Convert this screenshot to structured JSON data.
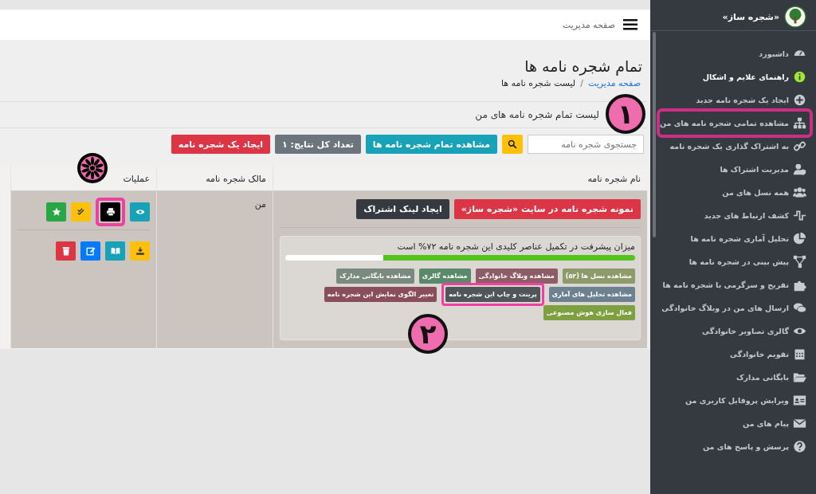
{
  "topbar": {
    "title": "صفحه مدیریت"
  },
  "sidebar": {
    "brand": "«شجره ساز»",
    "items": [
      {
        "label": "داشبورد",
        "emphasized": false,
        "annotated": false
      },
      {
        "label": "راهنمای علایم و اشکال",
        "emphasized": true,
        "annotated": false
      },
      {
        "label": "ایجاد یک شجره نامه جدید",
        "emphasized": false,
        "annotated": false
      },
      {
        "label": "مشاهده تمامی شجره نامه های من",
        "emphasized": false,
        "annotated": true
      },
      {
        "label": "به اشتراک گذاری یک شجره نامه",
        "emphasized": false,
        "annotated": false
      },
      {
        "label": "مدیریت اشتراک ها",
        "emphasized": false,
        "annotated": false
      },
      {
        "label": "همه نسل های من",
        "emphasized": false,
        "annotated": false
      },
      {
        "label": "کشف ارتباط های جدید",
        "emphasized": false,
        "annotated": false
      },
      {
        "label": "تحلیل آماری شجره نامه ها",
        "emphasized": false,
        "annotated": false
      },
      {
        "label": "پیش بینی در شجره نامه ها",
        "emphasized": false,
        "annotated": false
      },
      {
        "label": "تفریح و سرگرمی با شجره نامه ها",
        "emphasized": false,
        "annotated": false
      },
      {
        "label": "ارسال های من در وبلاگ خانوادگی",
        "emphasized": false,
        "annotated": false
      },
      {
        "label": "گالری تصاویر خانوادگی",
        "emphasized": false,
        "annotated": false
      },
      {
        "label": "تقویم خانوادگی",
        "emphasized": false,
        "annotated": false
      },
      {
        "label": "بایگانی مدارک",
        "emphasized": false,
        "annotated": false
      },
      {
        "label": "ویرایش پروفایل کاربری من",
        "emphasized": false,
        "annotated": false
      },
      {
        "label": "پیام های من",
        "emphasized": false,
        "annotated": false
      },
      {
        "label": "پرسش و پاسخ های من",
        "emphasized": false,
        "annotated": false
      }
    ]
  },
  "page": {
    "title": "تمام شجره نامه ها",
    "separator": "/",
    "breadcrumb": [
      {
        "label": "صفحه مدیریت",
        "kind": "link"
      },
      {
        "label": "لیست شجره نامه ها",
        "kind": "current"
      }
    ]
  },
  "card": {
    "heading": "لیست تمام شجره نامه های من",
    "search": {
      "placeholder": "جستجوی شجره نامه"
    },
    "toolbar": [
      {
        "label": "مشاهده تمام شجره نامه ها",
        "color": "#17a2b8"
      },
      {
        "label": "تعداد کل نتایج: ۱",
        "color": "#6c757d"
      },
      {
        "label": "ایجاد یک شجره نامه",
        "color": "#dc3545"
      }
    ],
    "table": {
      "columns": [
        "نام شجره نامه",
        "مالک شجره نامه",
        "عملیات"
      ],
      "rows": [
        {
          "buttons": [
            {
              "label": "نمونه شجره نامه در سایت «شجره ساز»",
              "color": "#dc3545"
            },
            {
              "label": "ایجاد لینک اشتراک",
              "color": "#343a40"
            }
          ],
          "progress": {
            "text": "میزان پیشرفت در تکمیل عناصر کلیدی این شجره نامه ۷۲% است",
            "level": 0.72
          },
          "tags": [
            {
              "label": "مشاهده نسل ها (۵۲)",
              "color": "#8f9a6a",
              "annotated": false
            },
            {
              "label": "مشاهده وبلاگ خانوادگی",
              "color": "#8e5d69",
              "annotated": false
            },
            {
              "label": "مشاهده گالری",
              "color": "#5b8a6a",
              "annotated": false
            },
            {
              "label": "مشاهده بایگانی مدارک",
              "color": "#7b8a80",
              "annotated": false
            },
            {
              "label": "مشاهده تحلیل های آماری",
              "color": "#6e8190",
              "annotated": false
            },
            {
              "label": "پرینت و چاپ این شجره نامه",
              "color": "#4f5559",
              "annotated": true
            },
            {
              "label": "تغییر الگوی نمایش این شجره نامه",
              "color": "#8a4e5a",
              "annotated": false
            },
            {
              "label": "فعال سازی هوش مصنوعی",
              "color": "#7fa040",
              "annotated": false
            }
          ],
          "owner": "من",
          "actions": [
            [
              {
                "kind": "view",
                "color": "#17a2b8",
                "annotated": false
              },
              {
                "kind": "print",
                "color": "#000000",
                "annotated": true
              },
              {
                "kind": "check",
                "color": "#ffc107",
                "annotated": false
              },
              {
                "kind": "star",
                "color": "#28a745",
                "annotated": false
              }
            ],
            [
              {
                "kind": "download",
                "color": "#ffc107",
                "annotated": false
              },
              {
                "kind": "book",
                "color": "#17a2b8",
                "annotated": false
              },
              {
                "kind": "edit",
                "color": "#007bff",
                "annotated": false
              },
              {
                "kind": "delete",
                "color": "#dc3545",
                "annotated": false
              }
            ]
          ]
        }
      ]
    }
  },
  "annotations": [
    {
      "kind": "number",
      "label": "۱"
    },
    {
      "kind": "number",
      "label": "۲"
    },
    {
      "kind": "flower"
    }
  ]
}
